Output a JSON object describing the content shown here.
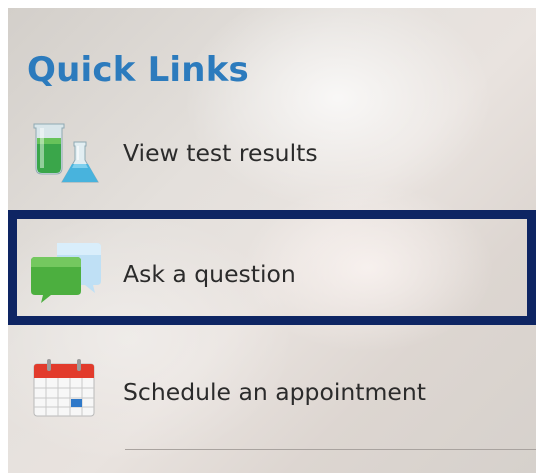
{
  "quick_links": {
    "title": "Quick Links",
    "items": [
      {
        "label": "View test results",
        "icon": "test-tubes-icon"
      },
      {
        "label": "Ask a question",
        "icon": "chat-bubbles-icon",
        "selected": true
      },
      {
        "label": "Schedule an appointment",
        "icon": "calendar-icon"
      }
    ]
  },
  "colors": {
    "title": "#2c7bbd",
    "selection_border": "#0e2563",
    "label": "#2b2b2b"
  }
}
